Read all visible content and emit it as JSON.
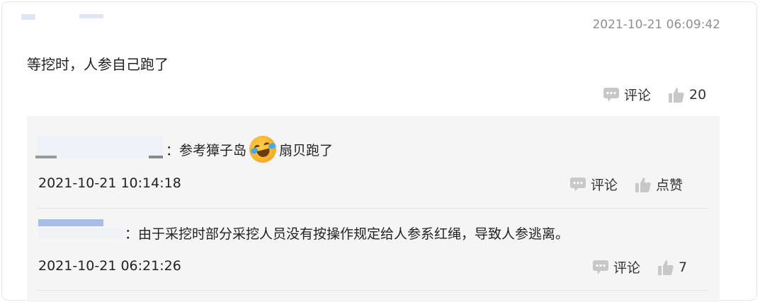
{
  "comment": {
    "timestamp": "2021-10-21 06:09:42",
    "text": "等挖时，人参自己跑了",
    "comment_label": "评论",
    "like_count": "20"
  },
  "replies": [
    {
      "text_before": "：参考獐子岛",
      "text_after": "扇贝跑了",
      "emoji": "crying-laughing-emoji",
      "timestamp": "2021-10-21 10:14:18",
      "comment_label": "评论",
      "like_label": "点赞"
    },
    {
      "text": "：由于采挖时部分采挖人员没有按操作规定给人参系红绳，导致人参逃离。",
      "timestamp": "2021-10-21 06:21:26",
      "comment_label": "评论",
      "like_count": "7"
    }
  ],
  "colors": {
    "reply_background": "#f5f5f5",
    "icon_gray": "#c8c8c8",
    "blur_blue": "#e7edf9",
    "timestamp_gray": "#8f8f8f"
  }
}
